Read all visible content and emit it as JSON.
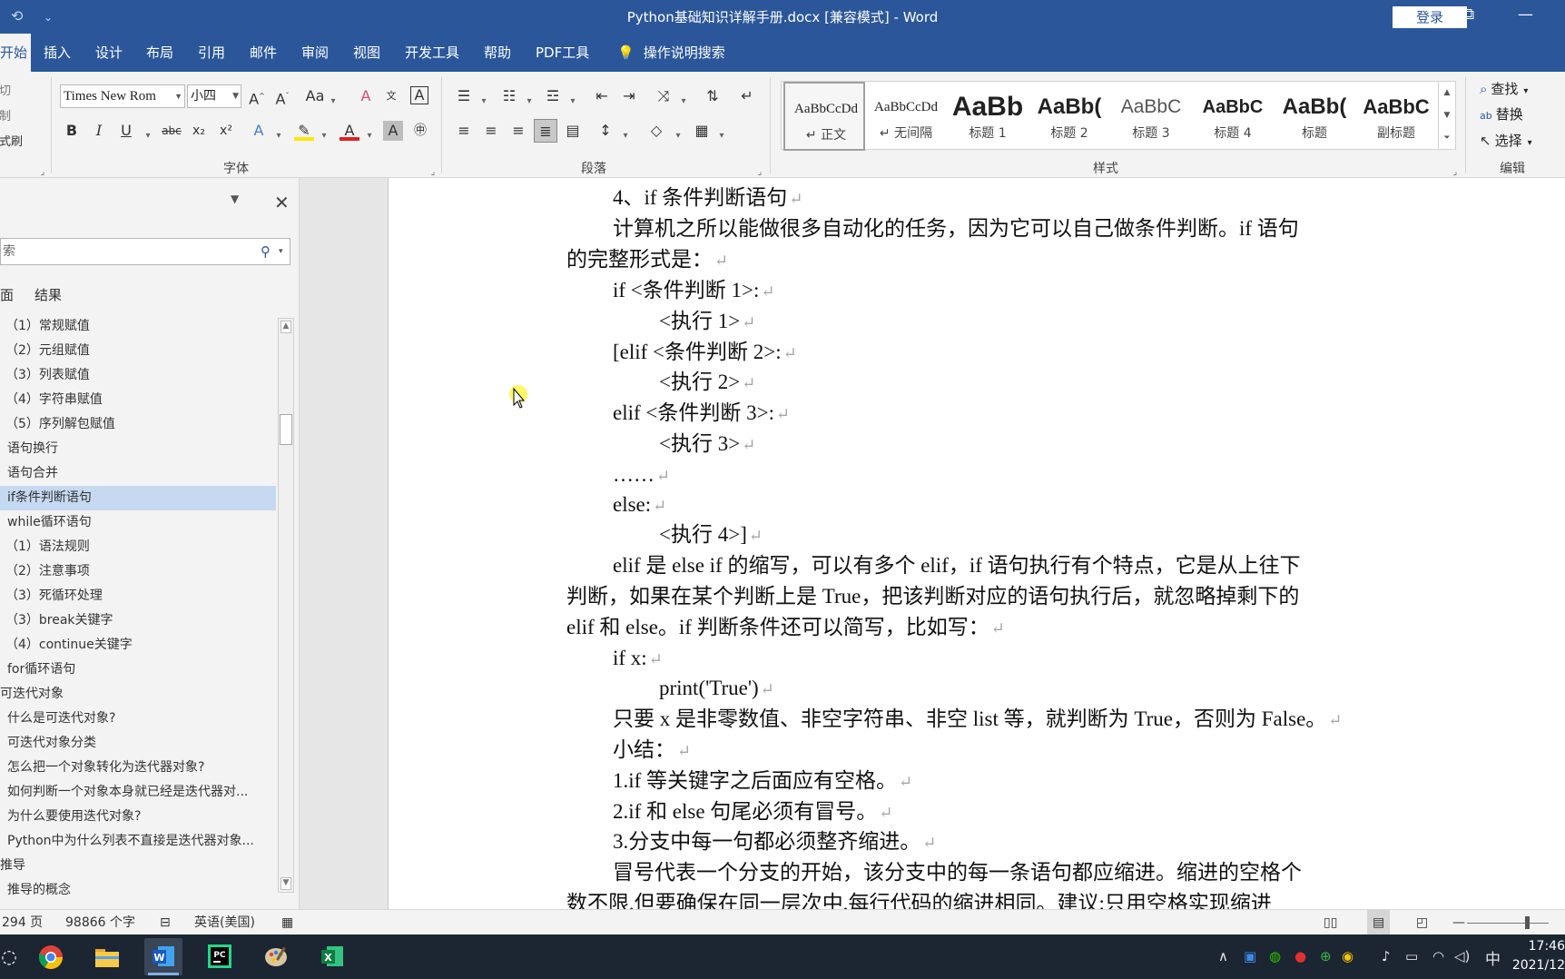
{
  "titlebar": {
    "title": "Python基础知识详解手册.docx [兼容模式]  -  Word",
    "login": "登录",
    "undo_icon": "undo-icon",
    "customize_icon": "customize-quick-access-icon",
    "minimize_icon": "minimize-icon",
    "restore_icon": "ribbon-display-options-icon"
  },
  "tabs": [
    {
      "label": "开始",
      "active": true
    },
    {
      "label": "插入"
    },
    {
      "label": "设计"
    },
    {
      "label": "布局"
    },
    {
      "label": "引用"
    },
    {
      "label": "邮件"
    },
    {
      "label": "审阅"
    },
    {
      "label": "视图"
    },
    {
      "label": "开发工具"
    },
    {
      "label": "帮助"
    },
    {
      "label": "PDF工具"
    }
  ],
  "tellme": "操作说明搜索",
  "clipboard": {
    "cut": "剪切",
    "copy": "复制",
    "format_painter": "格式刷"
  },
  "font": {
    "name": "Times New Rom",
    "size": "小四",
    "group_label": "字体"
  },
  "paragraph": {
    "group_label": "段落"
  },
  "styles": {
    "group_label": "样式",
    "items": [
      {
        "sample": "AaBbCcDd",
        "name": "↵ 正文"
      },
      {
        "sample": "AaBbCcDd",
        "name": "↵ 无间隔"
      },
      {
        "sample": "AaBb",
        "name": "标题 1"
      },
      {
        "sample": "AaBb(",
        "name": "标题 2"
      },
      {
        "sample": "AaBbC",
        "name": "标题 3"
      },
      {
        "sample": "AaBbC",
        "name": "标题 4"
      },
      {
        "sample": "AaBb(",
        "name": "标题"
      },
      {
        "sample": "AaBbC",
        "name": "副标题"
      }
    ]
  },
  "editing": {
    "find": "查找",
    "replace": "替换",
    "select": "选择",
    "group_label": "编辑"
  },
  "nav": {
    "search_placeholder": "索",
    "tab_headings": "面",
    "tab_results": "结果",
    "items": [
      {
        "label": "（1）常规赋值"
      },
      {
        "label": "（2）元组赋值"
      },
      {
        "label": "（3）列表赋值"
      },
      {
        "label": "（4）字符串赋值"
      },
      {
        "label": "（5）序列解包赋值"
      },
      {
        "label": "语句换行"
      },
      {
        "label": "语句合并"
      },
      {
        "label": "if条件判断语句",
        "active": true
      },
      {
        "label": "while循环语句"
      },
      {
        "label": "（1）语法规则"
      },
      {
        "label": "（2）注意事项"
      },
      {
        "label": "（3）死循环处理"
      },
      {
        "label": "（3）break关键字"
      },
      {
        "label": "（4）continue关键字"
      },
      {
        "label": "for循环语句"
      },
      {
        "label": "可迭代对象"
      },
      {
        "label": "什么是可迭代对象?"
      },
      {
        "label": "可迭代对象分类"
      },
      {
        "label": "怎么把一个对象转化为迭代器对象?"
      },
      {
        "label": "如何判断一个对象本身就已经是迭代器对..."
      },
      {
        "label": "为什么要使用迭代对象?"
      },
      {
        "label": "Python中为什么列表不直接是迭代器对象..."
      },
      {
        "label": "推导"
      },
      {
        "label": "推导的概念"
      }
    ]
  },
  "document": {
    "lines": [
      {
        "text": "4、if 条件判断语句"
      },
      {
        "text": "计算机之所以能做很多自动化的任务，因为它可以自己做条件判断。if 语句"
      },
      {
        "text": "的完整形式是："
      },
      {
        "text": "if <条件判断 1>:"
      },
      {
        "text": "<执行 1>"
      },
      {
        "text": "[elif <条件判断 2>:"
      },
      {
        "text": "<执行 2>"
      },
      {
        "text": "elif <条件判断 3>:"
      },
      {
        "text": "<执行 3>"
      },
      {
        "text": "……"
      },
      {
        "text": "else:"
      },
      {
        "text": "<执行 4>]"
      },
      {
        "text": "elif 是 else if 的缩写，可以有多个 elif，if 语句执行有个特点，它是从上往下"
      },
      {
        "text": "判断，如果在某个判断上是 True，把该判断对应的语句执行后，就忽略掉剩下的"
      },
      {
        "text": "elif 和 else。if 判断条件还可以简写，比如写："
      },
      {
        "text": "if x:"
      },
      {
        "text": "print('True')"
      },
      {
        "text": "只要 x 是非零数值、非空字符串、非空 list 等，就判断为 True，否则为 False。"
      },
      {
        "text": "小结："
      },
      {
        "text": "1.if 等关键字之后面应有空格。"
      },
      {
        "text": "2.if  和 else 句尾必须有冒号。"
      },
      {
        "text": "3.分支中每一句都必须整齐缩进。"
      },
      {
        "text": "冒号代表一个分支的开始，该分支中的每一条语句都应缩进。缩进的空格个"
      },
      {
        "text": "数不限,但要确保在同一层次中,每行代码的缩进相同。建议:只用空格实现缩进"
      }
    ]
  },
  "status": {
    "pages": "294 页",
    "words": "98866 个字",
    "language": "英语(美国)"
  },
  "taskbar": {
    "apps": [
      "chrome-icon",
      "file-explorer-icon",
      "word-icon",
      "pycharm-icon",
      "paint-icon",
      "excel-icon"
    ],
    "ime": "中",
    "time": "17:46",
    "date": "2021/12"
  }
}
